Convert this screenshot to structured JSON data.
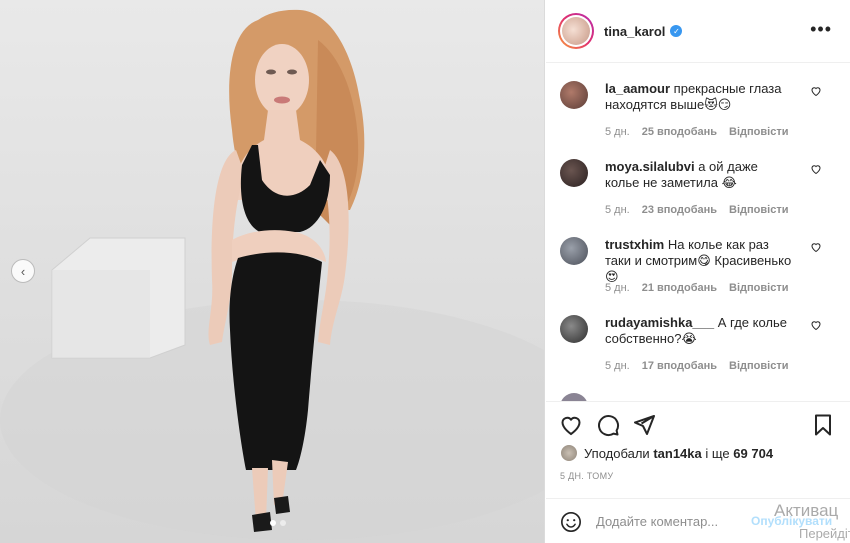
{
  "post": {
    "author": "tina_karol",
    "more_icon": "•••",
    "prev_icon": "‹",
    "slides": 2,
    "active_slide": 1
  },
  "comments": [
    {
      "user": "la_aamour",
      "text": "прекрасные глаза находятся выше😻😏",
      "age": "5 дн.",
      "likes": "25 вподобань",
      "reply": "Відповісти",
      "avatar_color": "#7a5c54"
    },
    {
      "user": "moya.silalubvi",
      "text": "а ой даже колье не заметила 😂",
      "age": "5 дн.",
      "likes": "23 вподобань",
      "reply": "Відповісти",
      "avatar_color": "#3b2f2c"
    },
    {
      "user": "trustxhim",
      "text": "На колье как раз таки и смотрим😋 Красивенько😍",
      "age": "5 дн.",
      "likes": "21 вподобань",
      "reply": "Відповісти",
      "avatar_color": "#6b6f78"
    },
    {
      "user": "rudayamishka___",
      "text": "А где колье собственно?😭",
      "age": "5 дн.",
      "likes": "17 вподобань",
      "reply": "Відповісти",
      "avatar_color": "#4a4a4a"
    }
  ],
  "likes_line": {
    "prefix": "Уподобали",
    "user": "tan14ka",
    "suffix": "і ще",
    "count": "69 704"
  },
  "time": "5 ДН. ТОМУ",
  "comment_box": {
    "placeholder": "Додайте коментар...",
    "publish": "Опублікувати"
  },
  "watermark": {
    "line1": "Активац",
    "line2": "Перейдіть"
  },
  "colors": {
    "accent": "#3897f0",
    "verified": "#3897f0",
    "muted": "#8e8e8e"
  }
}
